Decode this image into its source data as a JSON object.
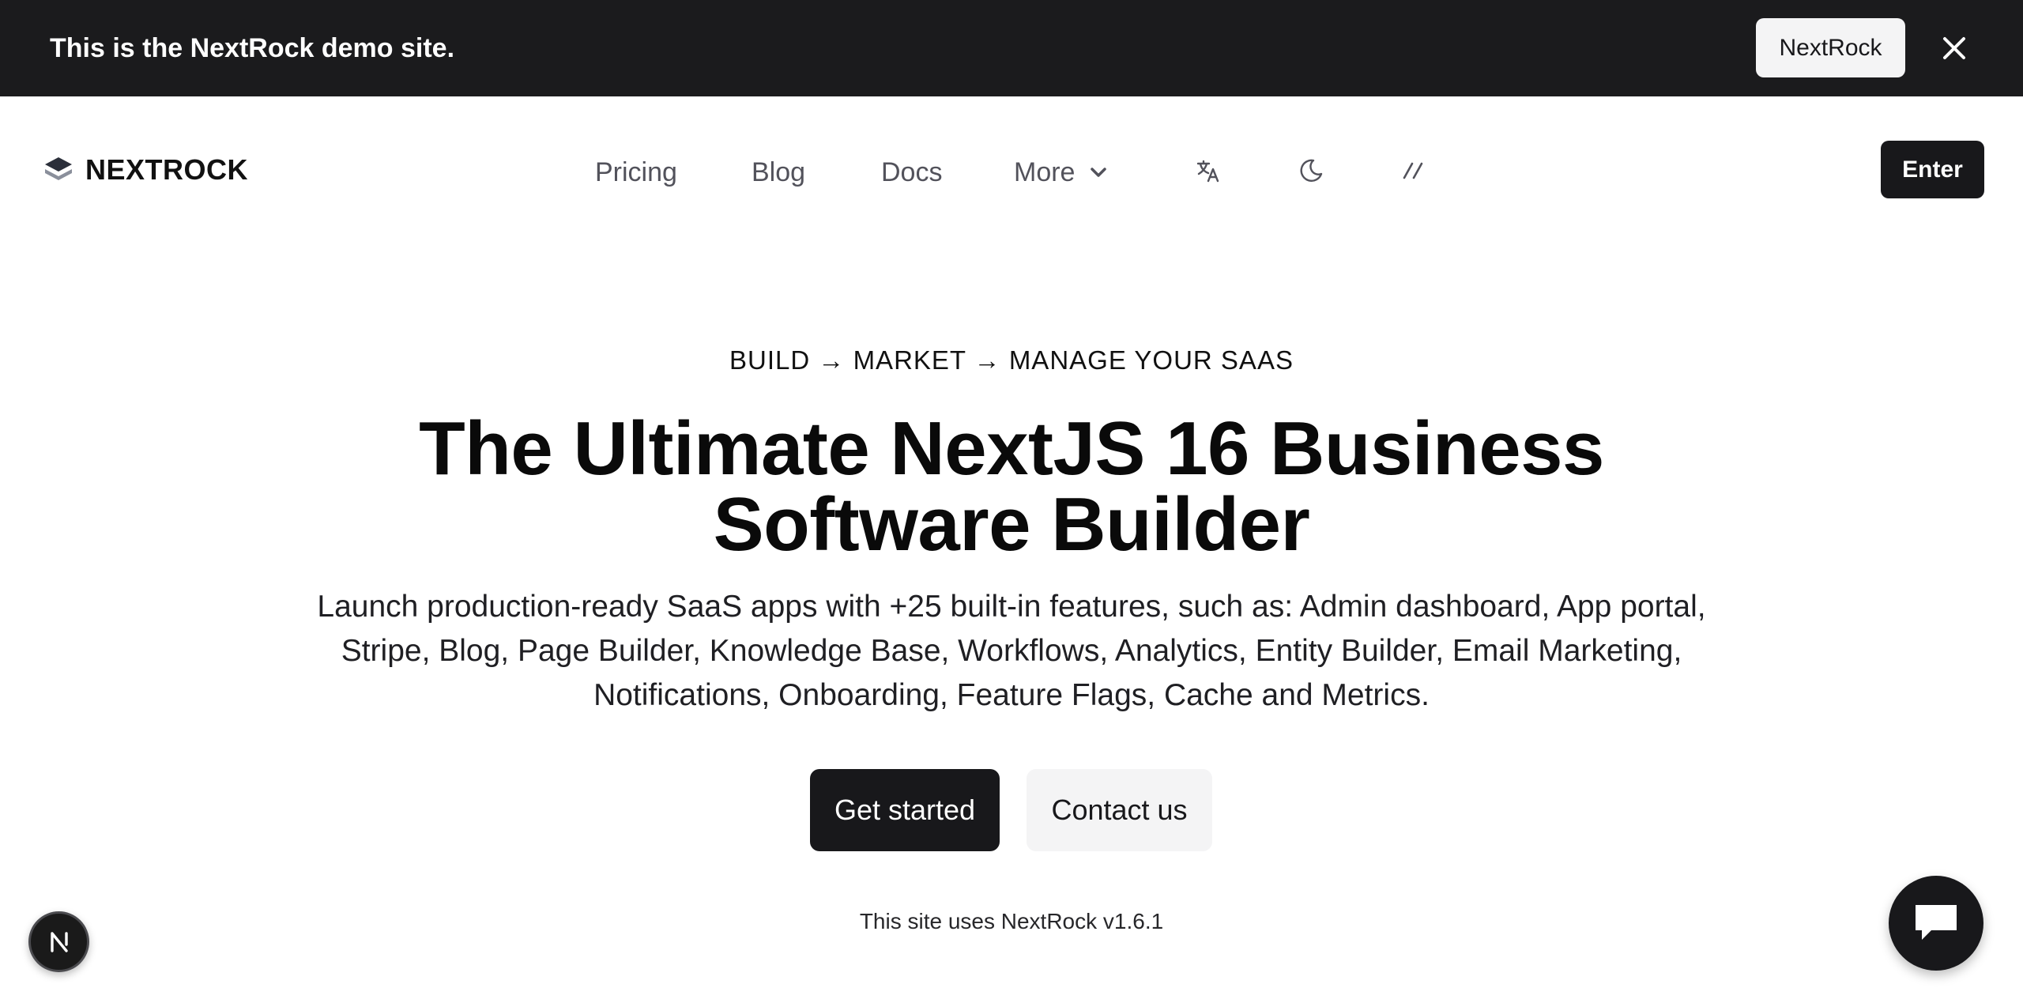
{
  "banner": {
    "message": "This is the NextRock demo site.",
    "button_label": "NextRock",
    "close_icon": "close-icon",
    "background": "#1b1b1d"
  },
  "navbar": {
    "logo_text": "NEXTROCK",
    "logo_icon": "layers-icon",
    "links": [
      "Pricing",
      "Blog",
      "Docs",
      "More"
    ],
    "more_icon": "chevron-down-icon",
    "icons": [
      "translate-icon",
      "moon-icon",
      "slashes-icon"
    ],
    "enter_label": "Enter"
  },
  "hero": {
    "eyebrow": "BUILD → MARKET → MANAGE YOUR SAAS",
    "headline_line1": "The Ultimate NextJS 16 Business",
    "headline_line2": "Software Builder",
    "subtext": "Launch production-ready SaaS apps with +25 built-in features, such as: Admin dashboard, App portal, Stripe, Blog, Page Builder, Knowledge Base, Workflows, Analytics, Entity Builder, Email Marketing, Notifications, Onboarding, Feature Flags, Cache and Metrics.",
    "primary_button": "Get started",
    "secondary_button": "Contact us",
    "footnote": "This site uses NextRock v1.6.1"
  },
  "floating": {
    "next_badge_letter": "N",
    "chat_icon": "chat-bubble-icon"
  },
  "colors": {
    "accent_dark": "#18181b",
    "muted_nav": "#52525b",
    "secondary_bg": "#f4f4f5"
  }
}
